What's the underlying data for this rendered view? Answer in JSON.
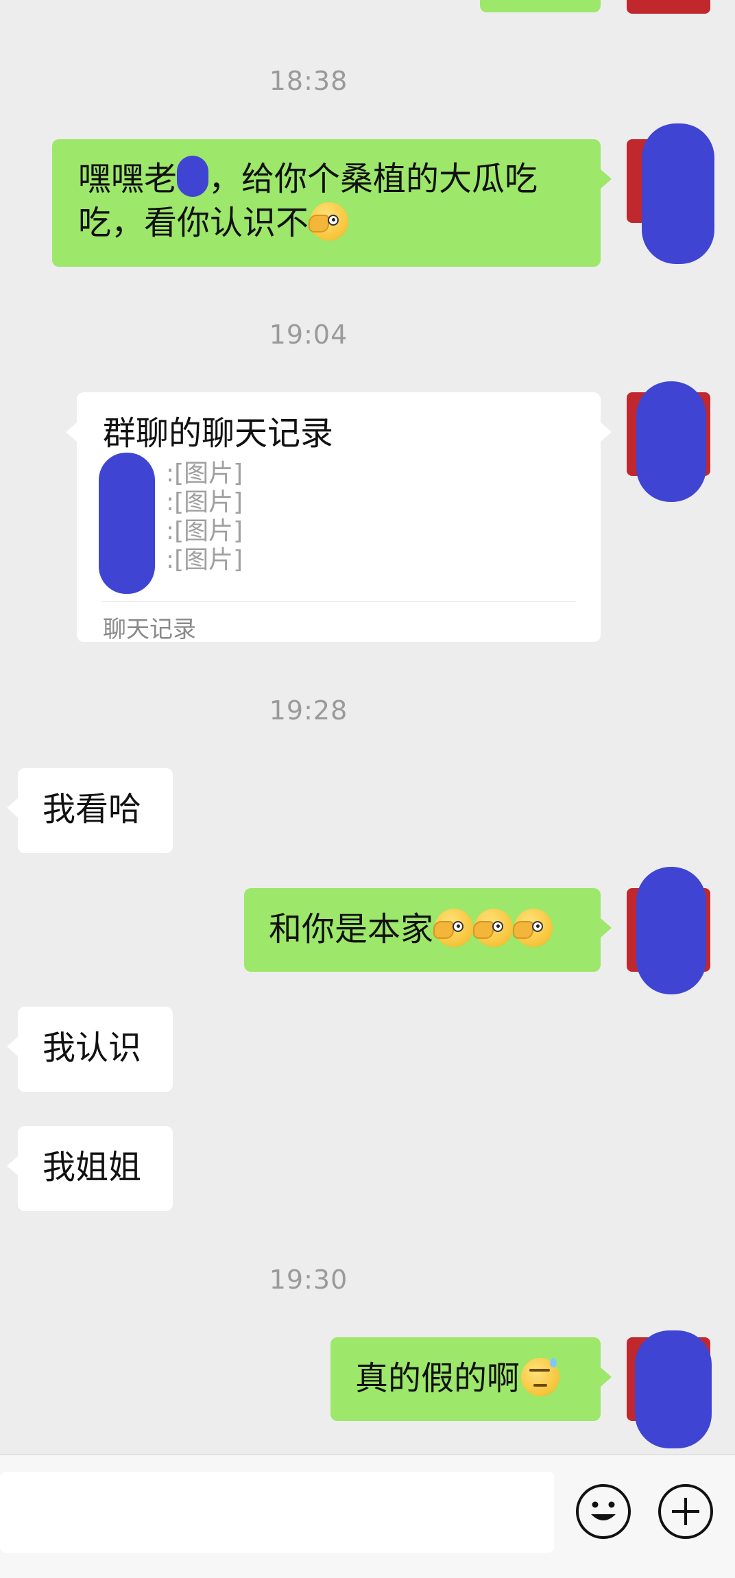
{
  "timestamps": {
    "t1": "18:38",
    "t2": "19:04",
    "t3": "19:28",
    "t4": "19:30"
  },
  "messages": {
    "m1": {
      "line1_a": "嘿嘿老",
      "line1_b": "，给你个桑植的大瓜吃",
      "line2": "吃，看你认识不",
      "emoji": "facepalm-peek-emoji"
    },
    "card": {
      "title": "群聊的聊天记录",
      "lines": [
        ":[图片]",
        ":[图片]",
        ":[图片]",
        ":[图片]"
      ],
      "footer": "聊天记录"
    },
    "m3": {
      "text": "我看哈"
    },
    "m4": {
      "text": "和你是本家",
      "emoji": "facepalm-peek-emoji"
    },
    "m5": {
      "text": "我认识"
    },
    "m6": {
      "text": "我姐姐"
    },
    "m7": {
      "text": "真的假的啊",
      "emoji": "sweat-emoji"
    }
  },
  "colors": {
    "background": "#ededed",
    "outgoing_bubble": "#9de76a",
    "incoming_bubble": "#ffffff",
    "avatar": "#c0282d",
    "redaction": "#3f45d2"
  },
  "input_bar": {
    "emoji_button_icon": "smiley-icon",
    "plus_button_icon": "plus-icon"
  }
}
